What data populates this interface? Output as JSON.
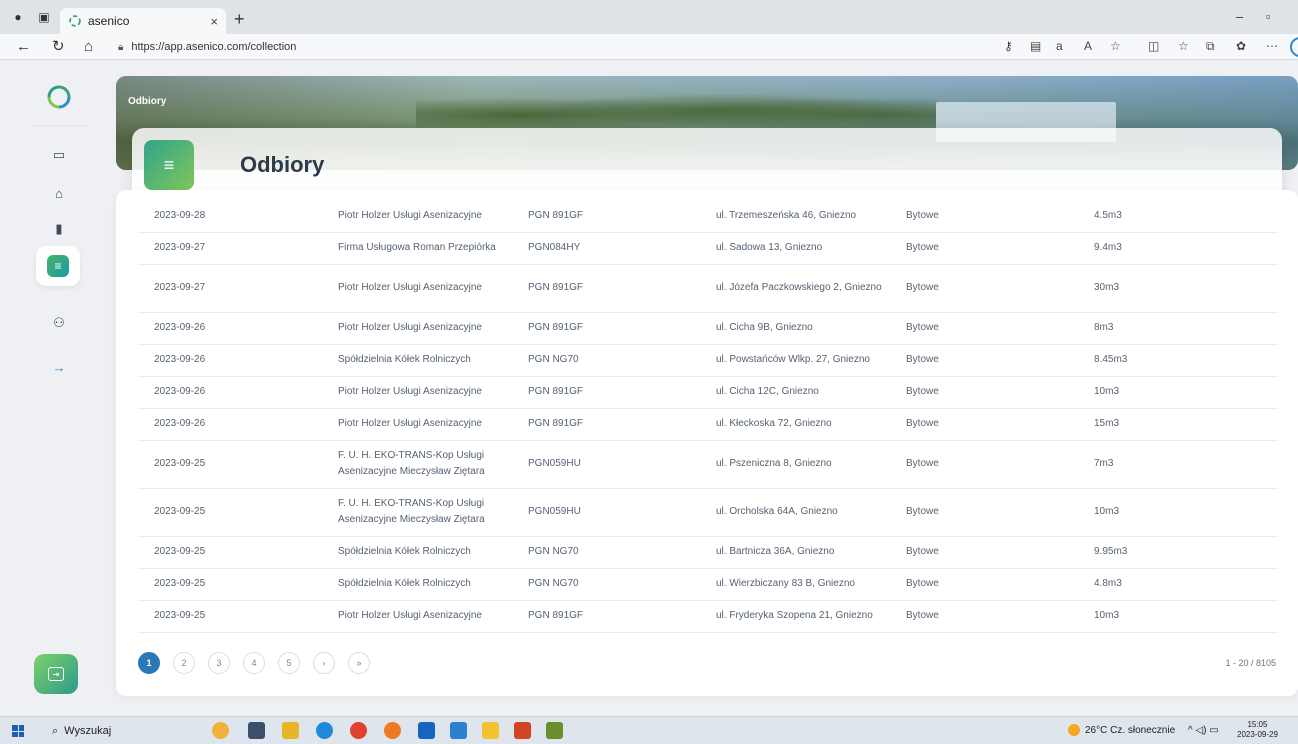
{
  "browser": {
    "tab_title": "asenico",
    "tab_close": "×",
    "new_tab": "+",
    "url": "https://app.asenico.com/collection",
    "minimize": "–",
    "restore": "▫"
  },
  "sidebar": {
    "items": [
      {
        "icon": "monitor-icon",
        "glyph": "▭"
      },
      {
        "icon": "home-icon",
        "glyph": "⌂"
      },
      {
        "icon": "truck-icon",
        "glyph": "▮"
      },
      {
        "icon": "collection-icon",
        "glyph": "≡"
      },
      {
        "icon": "users-icon",
        "glyph": "⚇"
      },
      {
        "icon": "arrow-right-icon",
        "glyph": "→"
      }
    ]
  },
  "hero": {
    "breadcrumb": "Odbiory",
    "title": "Odbiory"
  },
  "table": {
    "rows": [
      [
        "2023-09-28",
        "Piotr Holzer Usługi Asenizacyjne",
        "PGN 891GF",
        "ul. Trzemeszeńska 46, Gniezno",
        "Bytowe",
        "4.5m3"
      ],
      [
        "2023-09-27",
        "Firma Usługowa Roman Przepiórka",
        "PGN084HY",
        "ul. Sadowa 13, Gniezno",
        "Bytowe",
        "9.4m3"
      ],
      [
        "2023-09-27",
        "Piotr Holzer Usługi Asenizacyjne",
        "PGN 891GF",
        "ul. Józefa Paczkowskiego 2, Gniezno",
        "Bytowe",
        "30m3"
      ],
      [
        "2023-09-26",
        "Piotr Holzer Usługi Asenizacyjne",
        "PGN 891GF",
        "ul. Cicha 9B, Gniezno",
        "Bytowe",
        "8m3"
      ],
      [
        "2023-09-26",
        "Spółdzielnia Kółek Rolniczych",
        "PGN NG70",
        "ul. Powstańców Wlkp. 27, Gniezno",
        "Bytowe",
        "8.45m3"
      ],
      [
        "2023-09-26",
        "Piotr Holzer Usługi Asenizacyjne",
        "PGN 891GF",
        "ul. Cicha 12C, Gniezno",
        "Bytowe",
        "10m3"
      ],
      [
        "2023-09-26",
        "Piotr Holzer Usługi Asenizacyjne",
        "PGN 891GF",
        "ul. Kłeckoska 72, Gniezno",
        "Bytowe",
        "15m3"
      ],
      [
        "2023-09-25",
        "F. U. H. EKO-TRANS-Kop Usługi Asenizacyjne Mieczysław Ziętara",
        "PGN059HU",
        "ul. Pszeniczna 8, Gniezno",
        "Bytowe",
        "7m3"
      ],
      [
        "2023-09-25",
        "F. U. H. EKO-TRANS-Kop Usługi Asenizacyjne Mieczysław Ziętara",
        "PGN059HU",
        "ul. Orcholska 64A, Gniezno",
        "Bytowe",
        "10m3"
      ],
      [
        "2023-09-25",
        "Spółdzielnia Kółek Rolniczych",
        "PGN NG70",
        "ul. Bartnicza 36A, Gniezno",
        "Bytowe",
        "9.95m3"
      ],
      [
        "2023-09-25",
        "Spółdzielnia Kółek Rolniczych",
        "PGN NG70",
        "ul. Wierzbiczany 83 B, Gniezno",
        "Bytowe",
        "4.8m3"
      ],
      [
        "2023-09-25",
        "Piotr Holzer Usługi Asenizacyjne",
        "PGN 891GF",
        "ul. Fryderyka Szopena 21, Gniezno",
        "Bytowe",
        "10m3"
      ]
    ],
    "row_heights": [
      32,
      32,
      48,
      32,
      32,
      32,
      32,
      48,
      48,
      32,
      32,
      32
    ]
  },
  "pagination": {
    "pages": [
      "1",
      "2",
      "3",
      "4",
      "5"
    ],
    "next": "›",
    "last": "»",
    "active_page": "1",
    "range": "1 - 20 / 8105"
  },
  "taskbar": {
    "search_placeholder": "Wyszukaj",
    "weather": "26°C  Cz. słonecznie",
    "tray": "^ ◁) ▭",
    "time": "15:05",
    "date": "2023-09-29"
  },
  "colors": {
    "accent": "#2a78b6",
    "brand_gradient_start": "#2fa58a",
    "brand_gradient_end": "#7fc65a"
  }
}
